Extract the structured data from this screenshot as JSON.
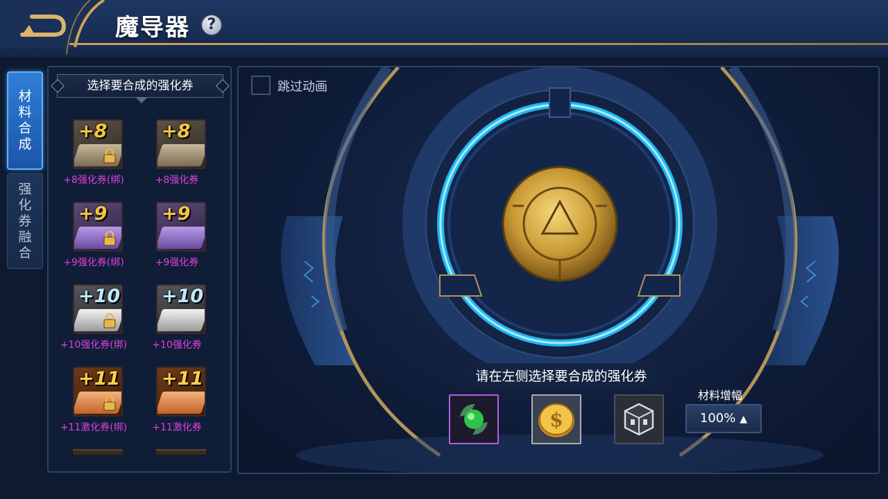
{
  "header": {
    "title": "魔导器",
    "help_symbol": "?"
  },
  "tabs": [
    {
      "chars": [
        "材",
        "料",
        "合",
        "成"
      ],
      "active": true
    },
    {
      "chars": [
        "强",
        "化",
        "券",
        "融",
        "合"
      ],
      "active": false
    }
  ],
  "panel": {
    "header": "选择要合成的强化券",
    "items": [
      {
        "badge": "+8",
        "label": "+8强化券(绑)",
        "locked": true
      },
      {
        "badge": "+8",
        "label": "+8强化券",
        "locked": false
      },
      {
        "badge": "+9",
        "label": "+9强化券(绑)",
        "locked": true
      },
      {
        "badge": "+9",
        "label": "+9强化券",
        "locked": false
      },
      {
        "badge": "+10",
        "label": "+10强化券(绑)",
        "locked": true
      },
      {
        "badge": "+10",
        "label": "+10强化券",
        "locked": false
      },
      {
        "badge": "+11",
        "label": "+11激化券(绑)",
        "locked": true
      },
      {
        "badge": "+11",
        "label": "+11激化券",
        "locked": false
      }
    ]
  },
  "main": {
    "skip_animation_label": "跳过动画",
    "hint": "请在左侧选择要合成的强化券",
    "materials": [
      "green-orb-icon",
      "gold-coin-icon",
      "dark-cube-icon"
    ],
    "boost_label": "材料增幅",
    "boost_value": "100%",
    "boost_arrow": "▲"
  },
  "colors": {
    "accent_gold": "#c9a25a",
    "tab_active": "#2f7fd8",
    "item_label": "#e040e0",
    "ring_cyan": "#25c8ff"
  }
}
